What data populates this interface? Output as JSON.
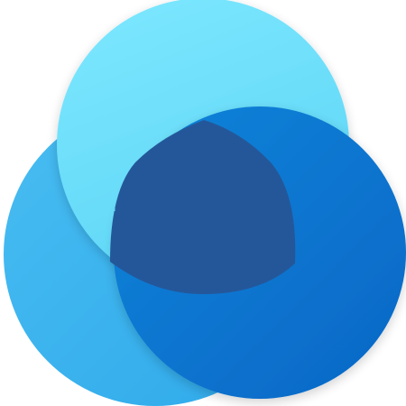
{
  "logo": {
    "icon": "three-overlapping-circles-logo",
    "colors": {
      "top_light": "#7ee8ff",
      "top_dark": "#5ed6f6",
      "left_light": "#2fa9ea",
      "left_dark": "#48bdf2",
      "right_light": "#0a84d9",
      "right_dark": "#0667c6",
      "center_triangle": "#24579a"
    }
  }
}
